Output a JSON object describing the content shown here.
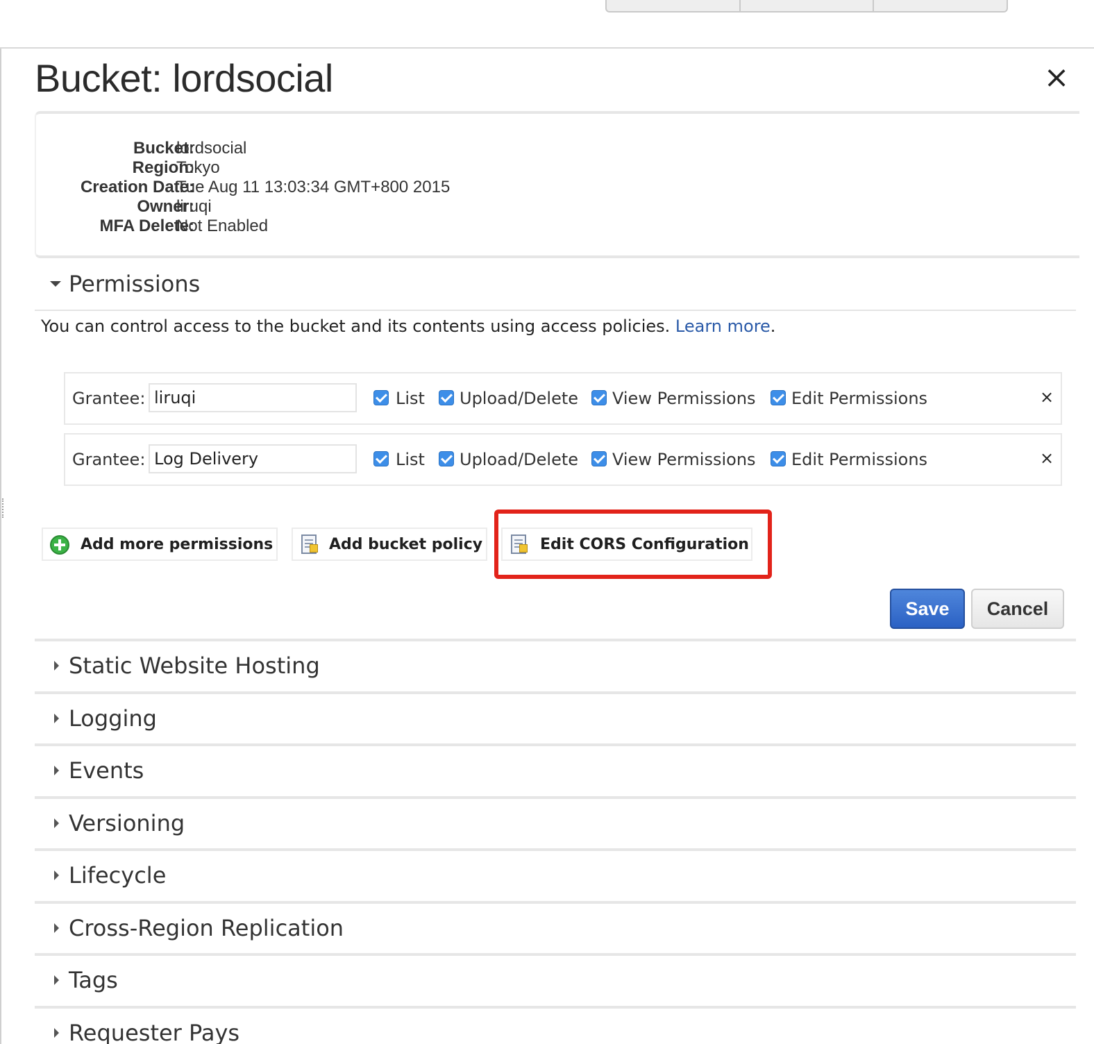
{
  "panel": {
    "title": "Bucket: lordsocial",
    "close_symbol": "×"
  },
  "info": [
    {
      "key": "Bucket:",
      "value": "lordsocial"
    },
    {
      "key": "Region:",
      "value": "Tokyo"
    },
    {
      "key": "Creation Date:",
      "value": "Tue Aug 11 13:03:34 GMT+800 2015"
    },
    {
      "key": "Owner:",
      "value": "liruqi"
    },
    {
      "key": "MFA Delete:",
      "value": "Not Enabled"
    }
  ],
  "permissions": {
    "title": "Permissions",
    "description": "You can control access to the bucket and its contents using access policies.",
    "learn_more": "Learn more",
    "period": ".",
    "grantee_label": "Grantee:",
    "checkbox_labels": [
      "List",
      "Upload/Delete",
      "View Permissions",
      "Edit Permissions"
    ],
    "remove_symbol": "×",
    "grantees": [
      {
        "name": "liruqi",
        "list": true,
        "upload_delete": true,
        "view_permissions": true,
        "edit_permissions": true
      },
      {
        "name": "Log Delivery",
        "list": true,
        "upload_delete": true,
        "view_permissions": true,
        "edit_permissions": true
      }
    ],
    "actions": {
      "add_more_permissions": "Add more permissions",
      "add_bucket_policy": "Add bucket policy",
      "edit_cors": "Edit CORS Configuration"
    },
    "save": "Save",
    "cancel": "Cancel"
  },
  "sections": [
    "Static Website Hosting",
    "Logging",
    "Events",
    "Versioning",
    "Lifecycle",
    "Cross-Region Replication",
    "Tags",
    "Requester Pays"
  ],
  "colors": {
    "highlight": "#e2231a",
    "save": "#2b61c4",
    "link": "#2a5aa8",
    "checkbox": "#3d8ee8"
  },
  "icons": {
    "add": "plus-circle-icon",
    "policy": "policy-document-icon",
    "cors": "policy-document-icon"
  }
}
